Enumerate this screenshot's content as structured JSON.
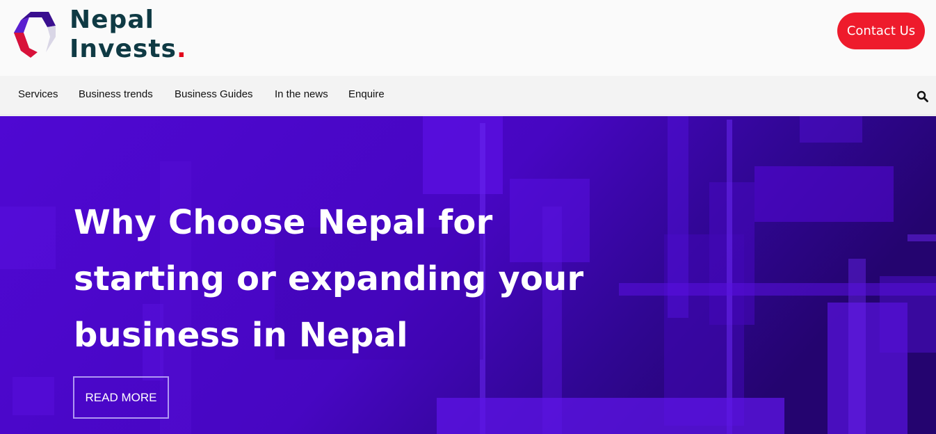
{
  "header": {
    "brand_line1": "Nepal",
    "brand_line2": "Invests",
    "brand_dot": ".",
    "contact_label": "Contact Us"
  },
  "nav": {
    "items": [
      "Services",
      "Business trends",
      "Business Guides",
      "In the news",
      "Enquire"
    ],
    "search_icon": "search-icon"
  },
  "hero": {
    "title": "Why Choose Nepal for starting or expanding your business in Nepal",
    "cta_label": "READ MORE"
  },
  "colors": {
    "brand_text": "#0f3a44",
    "accent_red": "#ee1b2c",
    "hero_purple": "#4a06c8",
    "logo_purple": "#4b0fa8"
  }
}
